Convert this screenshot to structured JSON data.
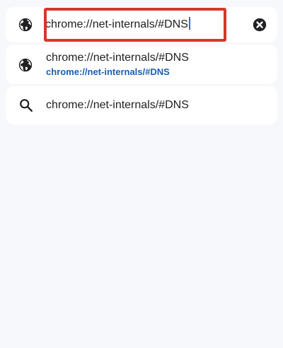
{
  "omnibox": {
    "value": "chrome://net-internals/#DNS",
    "leading_icon": "globe-icon",
    "clear_icon": "clear-icon"
  },
  "suggestions": [
    {
      "icon": "globe-icon",
      "title": "chrome://net-internals/#DNS",
      "url": "chrome://net-internals/#DNS"
    },
    {
      "icon": "search-icon",
      "title": "chrome://net-internals/#DNS"
    }
  ],
  "colors": {
    "background": "#f7f8fc",
    "card": "#ffffff",
    "url_accent": "#1a5fb4",
    "highlight": "#d7362b",
    "caret": "#1a73e8"
  }
}
